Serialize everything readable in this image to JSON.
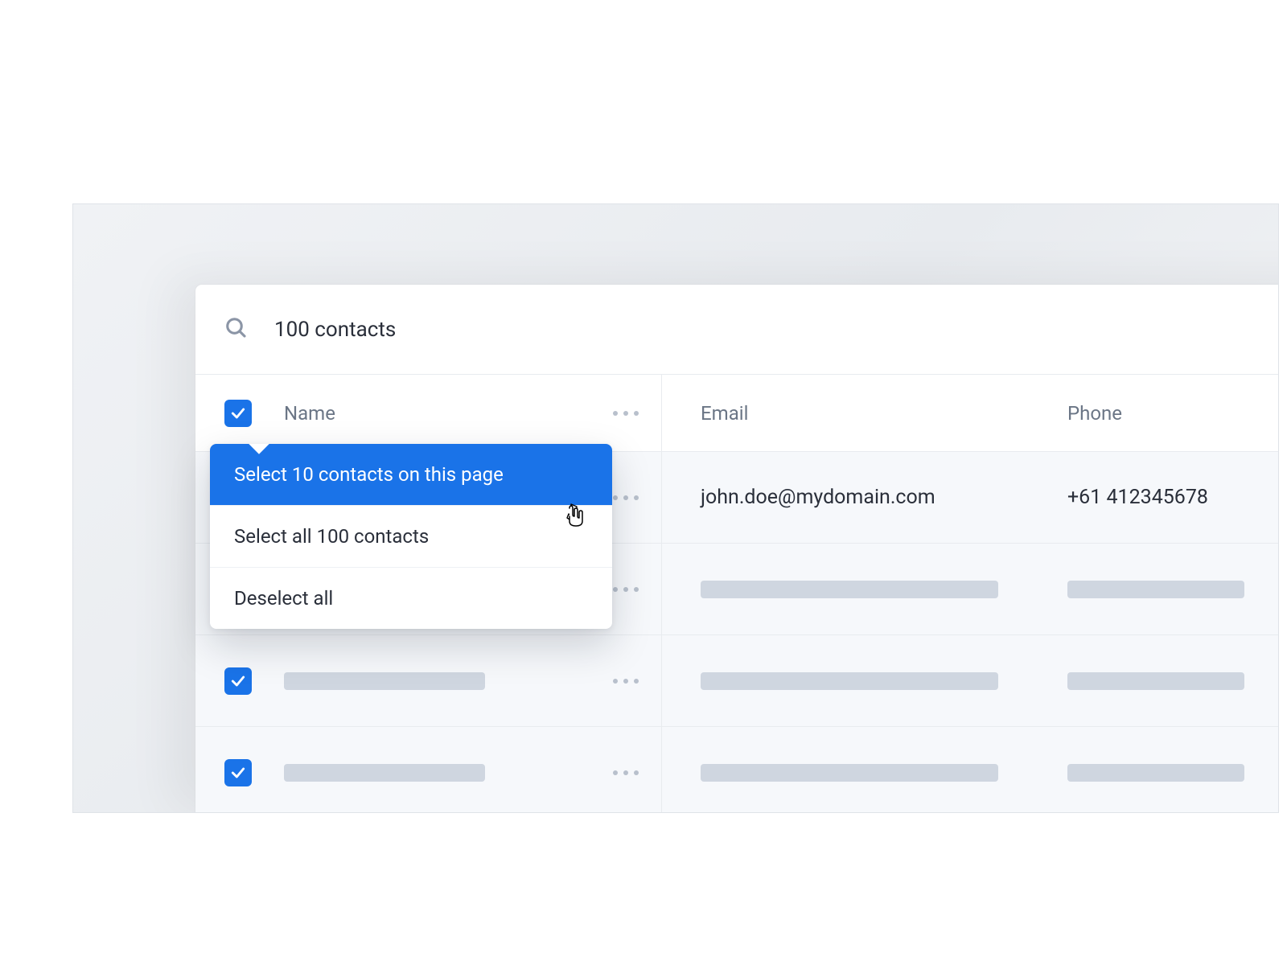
{
  "search": {
    "count_label": "100 contacts"
  },
  "columns": {
    "name": "Name",
    "email": "Email",
    "phone": "Phone"
  },
  "dropdown": {
    "select_page": "Select 10 contacts on this page",
    "select_all": "Select all 100 contacts",
    "deselect": "Deselect all"
  },
  "rows": [
    {
      "email": "john.doe@mydomain.com",
      "phone": "+61 412345678"
    }
  ],
  "colors": {
    "accent": "#1a73e8"
  }
}
